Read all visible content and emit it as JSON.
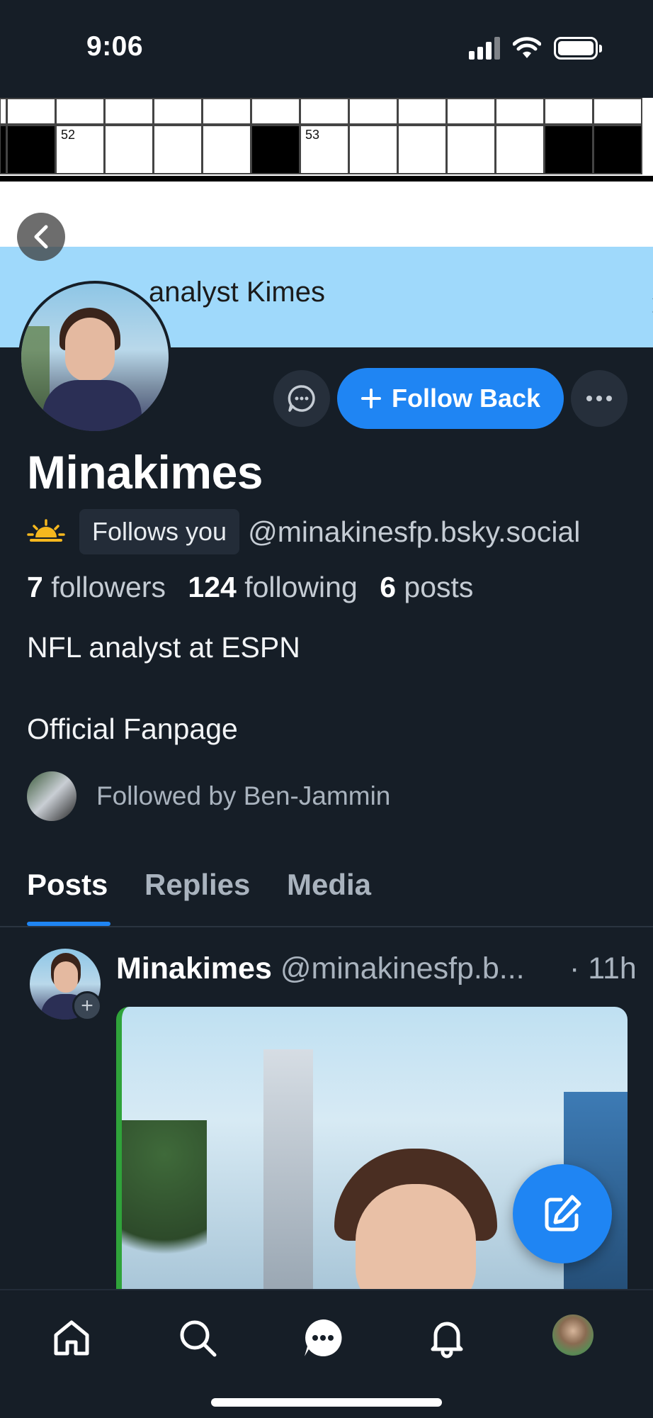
{
  "status_bar": {
    "time": "9:06"
  },
  "banner": {
    "crossword_numbers": [
      "52",
      "53"
    ],
    "text": "NFL analyst Kimes",
    "text_visible": "analyst Kimes"
  },
  "actions": {
    "follow_label": "Follow Back"
  },
  "profile": {
    "display_name": "Minakimes",
    "follows_you": "Follows you",
    "handle": "@minakinesfp.bsky.social",
    "followers_count": "7",
    "followers_label": "followers",
    "following_count": "124",
    "following_label": "following",
    "posts_count": "6",
    "posts_label": "posts",
    "bio_line1": "NFL analyst at ESPN",
    "bio_line2": "Official Fanpage",
    "followed_by": "Followed by Ben-Jammin"
  },
  "tabs": [
    {
      "label": "Posts",
      "active": true
    },
    {
      "label": "Replies",
      "active": false
    },
    {
      "label": "Media",
      "active": false
    }
  ],
  "post": {
    "author": "Minakimes",
    "handle": "@minakinesfp.b...",
    "time": "· 11h"
  },
  "nav": [
    "home-icon",
    "search-icon",
    "chat-icon",
    "bell-icon",
    "profile-avatar"
  ],
  "colors": {
    "accent": "#1f85f3",
    "background": "#161e27",
    "banner": "#9fd9fb"
  }
}
